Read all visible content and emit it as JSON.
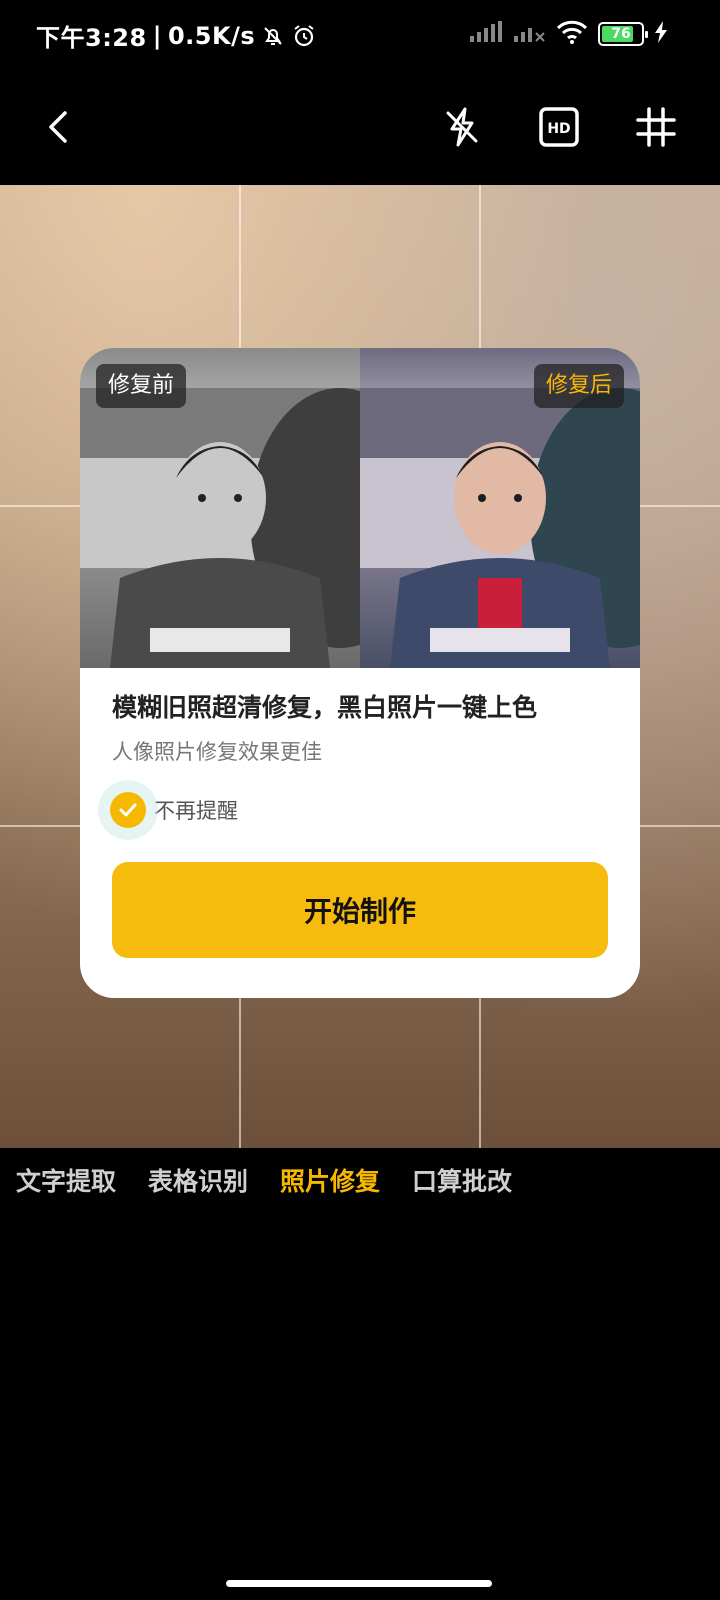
{
  "status_bar": {
    "time": "下午3:28",
    "net_speed": "0.5K/s",
    "battery_level": "76",
    "icons": [
      "mute-bell-icon",
      "alarm-icon",
      "signal-icon",
      "signal-x-icon",
      "wifi-icon",
      "battery-icon",
      "charging-icon"
    ]
  },
  "toolbar": {
    "icons": [
      "back-icon",
      "flash-off-icon",
      "hd-icon",
      "grid-icon"
    ]
  },
  "dialog": {
    "before_label": "修复前",
    "after_label": "修复后",
    "title": "模糊旧照超清修复，黑白照片一键上色",
    "subtitle": "人像照片修复效果更佳",
    "dont_remind_label": "不再提醒",
    "dont_remind_checked": true,
    "start_button": "开始制作"
  },
  "modes": {
    "items": [
      {
        "label": "文字提取"
      },
      {
        "label": "表格识别"
      },
      {
        "label": "照片修复"
      },
      {
        "label": "口算批改"
      }
    ],
    "active": "照片修复"
  },
  "colors": {
    "accent": "#f6b800",
    "button": "#f7bb0e"
  }
}
